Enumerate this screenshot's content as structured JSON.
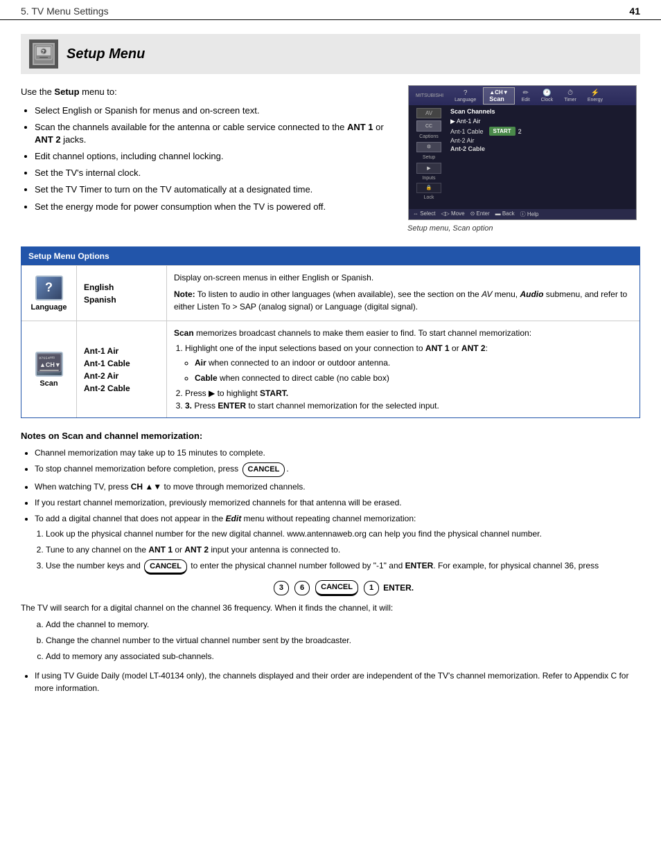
{
  "header": {
    "chapter": "5.  TV Menu Settings",
    "page_number": "41"
  },
  "section": {
    "title": "Setup Menu",
    "intro_paragraph": "Use the Setup menu to:",
    "bullets": [
      "Select English or Spanish for menus and on-screen text.",
      "Scan the channels available for the antenna or cable service connected to the ANT 1 or ANT 2 jacks.",
      "Edit channel options, including channel locking.",
      "Set the TV's internal clock.",
      "Set the TV Timer to turn on the TV automatically at a designated time.",
      "Set the energy mode for power consumption when the TV is powered off."
    ],
    "screenshot_caption": "Setup menu, Scan option"
  },
  "options_table": {
    "title": "Setup Menu Options",
    "rows": [
      {
        "icon_label": "Language",
        "values": [
          "English",
          "Spanish"
        ],
        "description_main": "Display on-screen menus in either English or Spanish.",
        "description_note": "Note: To listen to audio in other languages (when available), see  the section on the AV menu, Audio submenu, and refer to either Listen To > SAP (analog signal) or Language (digital signal)."
      },
      {
        "icon_label": "Scan",
        "values": [
          "Ant-1 Air",
          "Ant-1 Cable",
          "Ant-2 Air",
          "Ant-2 Cable"
        ],
        "description_main": "Scan memorizes broadcast channels to make them easier to find.  To start channel memorization:",
        "steps": [
          {
            "text": "Highlight one of the input selections based on your connection to ANT 1 or ANT 2:",
            "sub_bullets": [
              "Air when connected to an indoor or outdoor antenna.",
              "Cable when connected to direct cable (no cable box)"
            ]
          },
          {
            "text": "Press ▶ to highlight START."
          },
          {
            "text": "Press ENTER to start channel memorization for the selected input.",
            "bold_step": true
          }
        ]
      }
    ]
  },
  "notes": {
    "heading": "Notes on Scan and channel memorization:",
    "bullets": [
      "Channel memorization may take up to 15 minutes to complete.",
      "To stop channel memorization before completion, press CANCEL.",
      "When watching TV, press CH ▲▼ to move through memorized channels.",
      "If you restart channel memorization, previously memorized channels for that antenna will be erased.",
      "To add a digital channel that does not appear in the Edit menu without repeating channel memorization:",
      "The TV will search for a digital channel on the channel 36 frequency.  When it finds the channel, it will:"
    ],
    "sub_steps_add_digital": [
      "Look up the physical channel number for the new digital channel.   www.antennaweb.org can help you find the physical channel number.",
      "Tune to any channel on the ANT 1 or ANT 2 input your antenna is connected to.",
      "Use the number keys and CANCEL to enter the physical channel number followed by \"-1\" and ENTER.  For example, for physical channel 36, press"
    ],
    "key_sequence": [
      "3",
      "6",
      "CANCEL",
      "1",
      "ENTER"
    ],
    "tv_finds_bullets": [
      "Add the channel to memory.",
      "Change the channel number to the virtual channel number sent by the broadcaster.",
      "Add to memory any associated sub-channels."
    ],
    "final_bullet": "If using TV Guide Daily (model LT-40134 only), the channels displayed and their order are independent of the TV's channel memorization.  Refer to Appendix C for more information."
  }
}
